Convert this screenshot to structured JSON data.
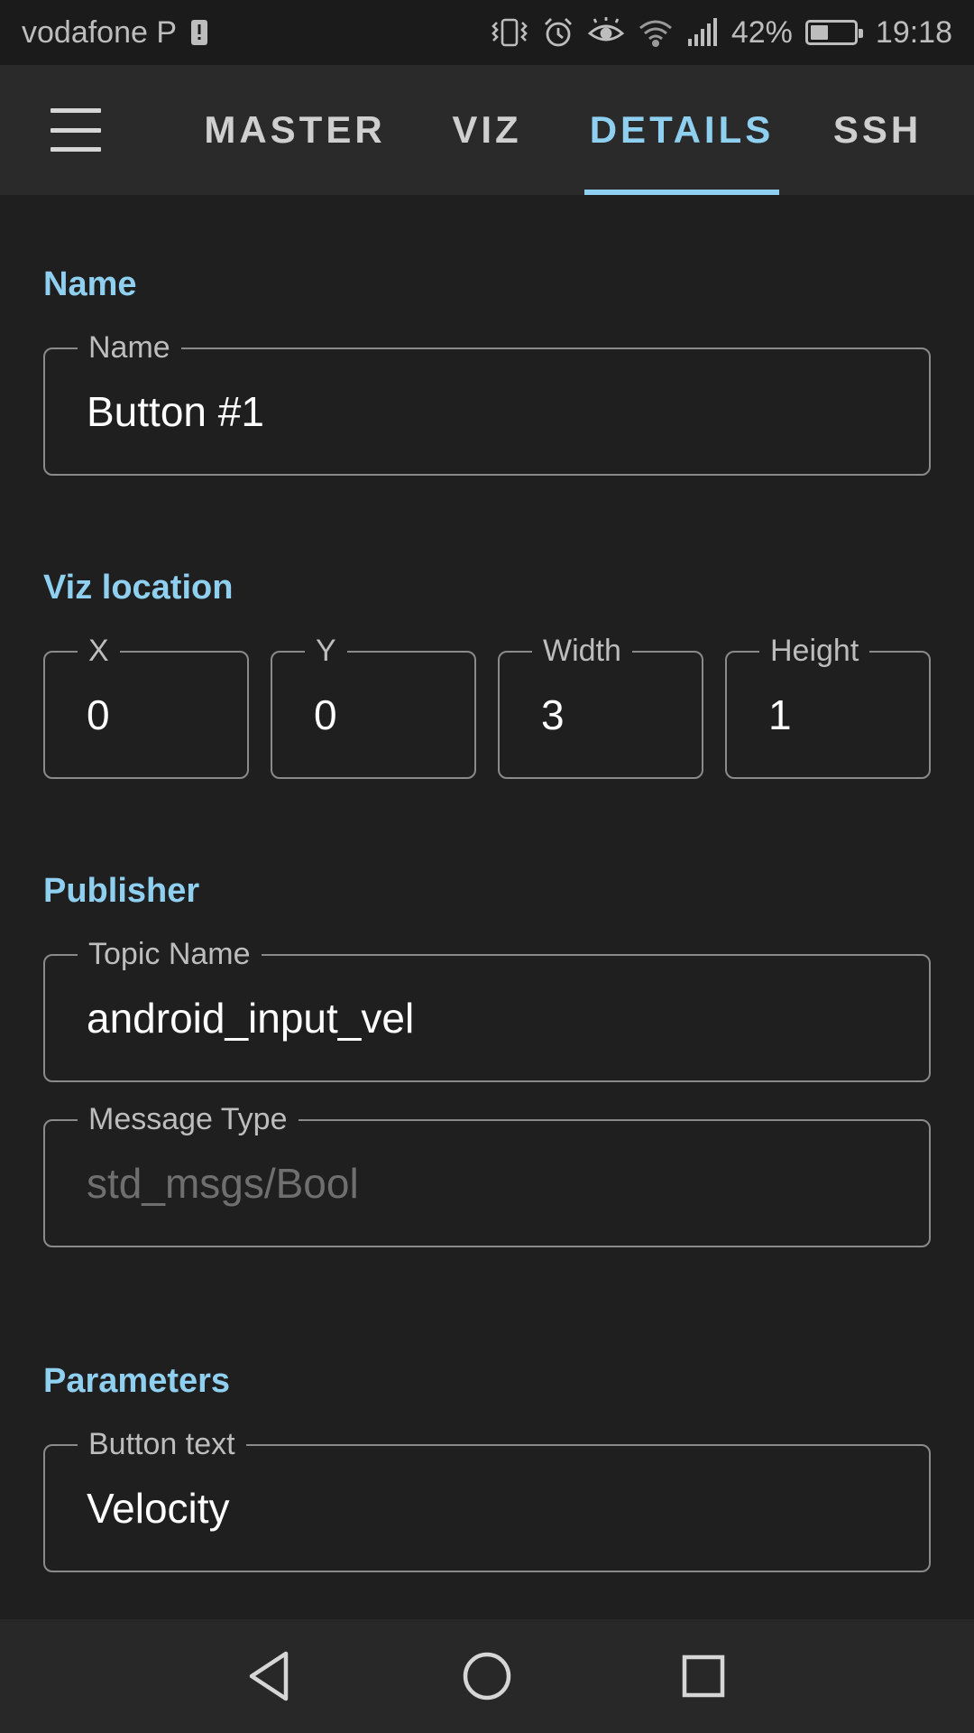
{
  "status_bar": {
    "carrier": "vodafone P",
    "battery_percent": "42%",
    "battery_level": 0.42,
    "time": "19:18",
    "icons": [
      "sim-alert-icon",
      "vibrate-icon",
      "alarm-icon",
      "eye-comfort-icon",
      "wifi-icon",
      "signal-icon",
      "battery-icon"
    ]
  },
  "app_bar": {
    "menu_icon": "hamburger-menu-icon",
    "tabs": [
      {
        "label": "MASTER",
        "active": false
      },
      {
        "label": "VIZ",
        "active": false
      },
      {
        "label": "DETAILS",
        "active": true
      },
      {
        "label": "SSH",
        "active": false
      }
    ]
  },
  "sections": {
    "name": {
      "title": "Name",
      "field": {
        "label": "Name",
        "value": "Button #1"
      }
    },
    "viz_location": {
      "title": "Viz location",
      "fields": [
        {
          "label": "X",
          "value": "0"
        },
        {
          "label": "Y",
          "value": "0"
        },
        {
          "label": "Width",
          "value": "3"
        },
        {
          "label": "Height",
          "value": "1"
        }
      ]
    },
    "publisher": {
      "title": "Publisher",
      "topic": {
        "label": "Topic Name",
        "value": "android_input_vel"
      },
      "message_type": {
        "label": "Message Type",
        "value": "std_msgs/Bool"
      }
    },
    "parameters": {
      "title": "Parameters",
      "button_text": {
        "label": "Button text",
        "value": "Velocity"
      }
    }
  },
  "nav_bar": {
    "icons": [
      "back-icon",
      "home-icon",
      "recents-icon"
    ]
  },
  "colors": {
    "accent": "#8fd0f0",
    "background": "#1f1f1f",
    "app_bar": "#2a2a2a",
    "field_border": "#8a8a8a"
  }
}
